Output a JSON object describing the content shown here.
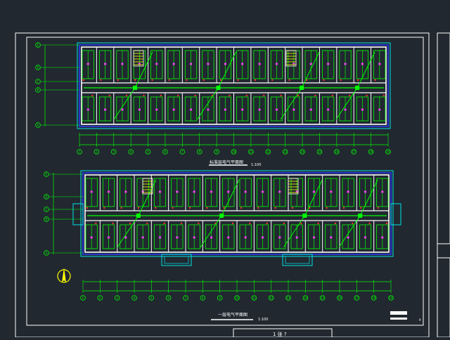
{
  "drawing": {
    "background": "#212830",
    "frame_color": "#ffffff",
    "upper_plan": {
      "title": "标准层电气平面图",
      "scale": "1:100",
      "axis_labels": [
        "1",
        "2",
        "3",
        "4",
        "5",
        "6",
        "7",
        "8",
        "9",
        "10",
        "11",
        "12",
        "13",
        "14",
        "15",
        "16",
        "17",
        "18",
        "19"
      ],
      "row_labels": [
        "E",
        "D",
        "C",
        "B",
        "A"
      ]
    },
    "lower_plan": {
      "title": "一层电气平面图",
      "scale": "1:100",
      "axis_labels": [
        "1",
        "2",
        "3",
        "4",
        "5",
        "6",
        "7",
        "8",
        "9",
        "10",
        "11",
        "12",
        "13",
        "14",
        "15",
        "16",
        "17",
        "18",
        "19"
      ],
      "row_labels": [
        "E",
        "D",
        "C",
        "B",
        "A"
      ]
    },
    "title_block": {
      "sheet_text": "1 张 ?",
      "page_number": "9"
    },
    "colors": {
      "wall": "#ffffff",
      "wiring": "#00ff00",
      "outline": "#00e5e5",
      "magenta": "#ff40ff",
      "red": "#ff3030",
      "yellow": "#ffff00",
      "blue": "#2a3cff"
    },
    "icons": [
      "north-arrow-icon"
    ]
  }
}
